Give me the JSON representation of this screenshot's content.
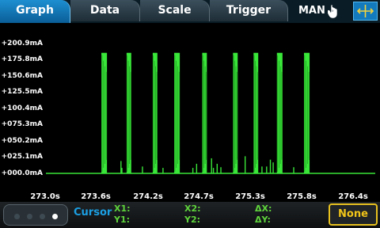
{
  "tabs": [
    {
      "label": "Graph",
      "active": true
    },
    {
      "label": "Data",
      "active": false
    },
    {
      "label": "Scale",
      "active": false
    },
    {
      "label": "Trigger",
      "active": false
    }
  ],
  "mode": {
    "label": "MAN",
    "icon": "hand-pointer-icon"
  },
  "pan_zoom_icon": "pan-zoom-icon",
  "colors": {
    "trace": "#39e639",
    "accent": "#1b9fe3",
    "cursor_text": "#5fd43c",
    "none_button": "#f0c419"
  },
  "chart_data": {
    "type": "line",
    "title": "",
    "xlabel": "",
    "ylabel": "",
    "x_ticks": [
      "273.0s",
      "273.6s",
      "274.2s",
      "274.7s",
      "275.3s",
      "275.8s",
      "276.4s"
    ],
    "y_ticks": [
      "+200.9mA",
      "+175.8mA",
      "+150.6mA",
      "+125.5mA",
      "+100.4mA",
      "+075.3mA",
      "+050.2mA",
      "+025.1mA",
      "+000.0mA"
    ],
    "xlim": [
      273.0,
      276.4
    ],
    "ylim": [
      0.0,
      200.9
    ],
    "grid": false,
    "series": [
      {
        "values_unit": "mA",
        "pulses": [
          {
            "start": 273.56,
            "end": 273.62,
            "peak": 175.8
          },
          {
            "start": 273.83,
            "end": 273.88,
            "peak": 175.8
          },
          {
            "start": 274.11,
            "end": 274.16,
            "peak": 175.8
          },
          {
            "start": 274.34,
            "end": 274.4,
            "peak": 175.8
          },
          {
            "start": 274.64,
            "end": 274.69,
            "peak": 175.8
          },
          {
            "start": 274.97,
            "end": 275.02,
            "peak": 175.8
          },
          {
            "start": 275.19,
            "end": 275.24,
            "peak": 175.8
          },
          {
            "start": 275.44,
            "end": 275.5,
            "peak": 175.8
          },
          {
            "start": 275.73,
            "end": 275.79,
            "peak": 175.8
          }
        ],
        "spikes": [
          {
            "x": 273.77,
            "y": 18.0
          },
          {
            "x": 273.78,
            "y": 8.0
          },
          {
            "x": 274.0,
            "y": 10.0
          },
          {
            "x": 274.22,
            "y": 8.0
          },
          {
            "x": 274.54,
            "y": 8.0
          },
          {
            "x": 274.58,
            "y": 14.0
          },
          {
            "x": 274.74,
            "y": 22.0
          },
          {
            "x": 274.76,
            "y": 8.0
          },
          {
            "x": 274.8,
            "y": 14.0
          },
          {
            "x": 274.84,
            "y": 9.0
          },
          {
            "x": 275.1,
            "y": 25.0
          },
          {
            "x": 275.28,
            "y": 10.0
          },
          {
            "x": 275.33,
            "y": 10.0
          },
          {
            "x": 275.37,
            "y": 20.0
          },
          {
            "x": 275.4,
            "y": 16.0
          },
          {
            "x": 275.62,
            "y": 9.0
          }
        ],
        "baseline": 0.0
      }
    ]
  },
  "bottom": {
    "cursor_title": "Cursor",
    "x1": "X1:",
    "y1": "Y1:",
    "x2": "X2:",
    "y2": "Y2:",
    "dx": "ΔX:",
    "dy": "ΔY:",
    "none_label": "None",
    "dots": 4,
    "active_dot": 3
  }
}
